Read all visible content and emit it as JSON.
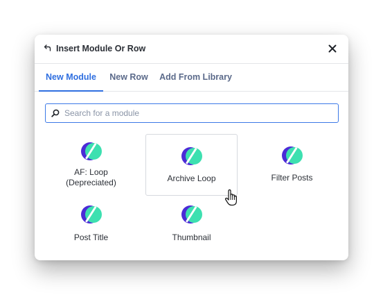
{
  "dialog": {
    "title": "Insert Module Or Row",
    "back_icon": "back-arrow-icon",
    "close_icon": "close-icon"
  },
  "tabs": [
    {
      "label": "New Module",
      "active": true
    },
    {
      "label": "New Row",
      "active": false
    },
    {
      "label": "Add From Library",
      "active": false
    }
  ],
  "search": {
    "placeholder": "Search for a module",
    "value": "",
    "icon": "search-icon"
  },
  "modules": [
    {
      "label_line1": "AF: Loop",
      "label_line2": "(Depreciated)"
    },
    {
      "label": "Archive Loop",
      "hovered": true
    },
    {
      "label": "Filter Posts"
    },
    {
      "label": "Post Title"
    },
    {
      "label": "Thumbnail"
    }
  ],
  "colors": {
    "accent": "#2f6fe0",
    "logo_purple": "#4b2bd6",
    "logo_green": "#3de0b0"
  }
}
